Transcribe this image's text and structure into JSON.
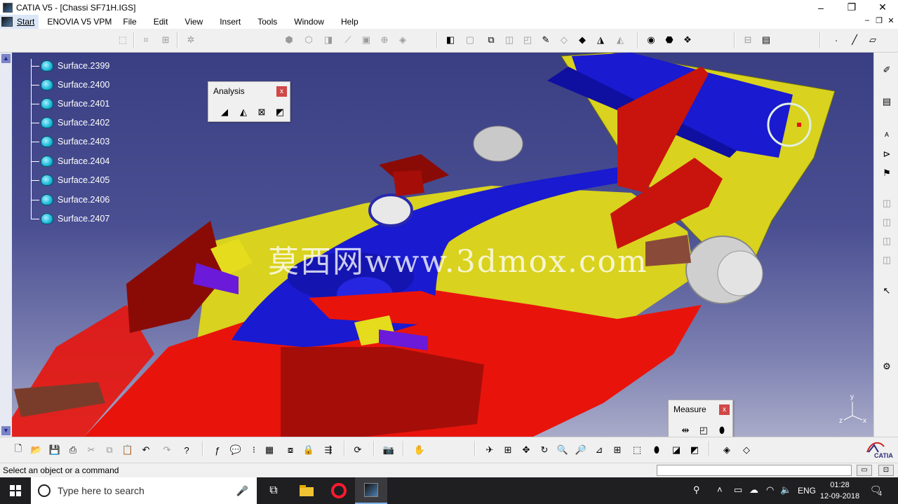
{
  "window": {
    "title": "CATIA V5 - [Chassi SF71H.IGS]",
    "minimize": "–",
    "restore": "❐",
    "close": "✕"
  },
  "menu": {
    "start": "Start",
    "items": [
      "ENOVIA V5 VPM",
      "File",
      "Edit",
      "View",
      "Insert",
      "Tools",
      "Window",
      "Help"
    ],
    "doc_minimize": "–",
    "doc_restore": "❐",
    "doc_close": "✕"
  },
  "tree": {
    "items": [
      "Surface.2399",
      "Surface.2400",
      "Surface.2401",
      "Surface.2402",
      "Surface.2403",
      "Surface.2404",
      "Surface.2405",
      "Surface.2406",
      "Surface.2407"
    ]
  },
  "watermark": "莫西网www.3dmox.com",
  "palettes": {
    "analysis": {
      "title": "Analysis",
      "close": "x"
    },
    "measure": {
      "title": "Measure",
      "close": "x"
    }
  },
  "axes": {
    "x": "x",
    "y": "y",
    "z": "z"
  },
  "catia_logo": "CATIA",
  "status": {
    "prompt": "Select an object or a command"
  },
  "taskbar": {
    "search_placeholder": "Type here to search",
    "language": "ENG",
    "time": "01:28",
    "date": "12-09-2018",
    "notifications": "4"
  },
  "colors": {
    "viewport_top": "#3a3f83",
    "viewport_bottom": "#a9abc9",
    "car_red": "#e8140c",
    "car_yellow": "#d9d21e",
    "car_blue": "#1a1ad0"
  }
}
